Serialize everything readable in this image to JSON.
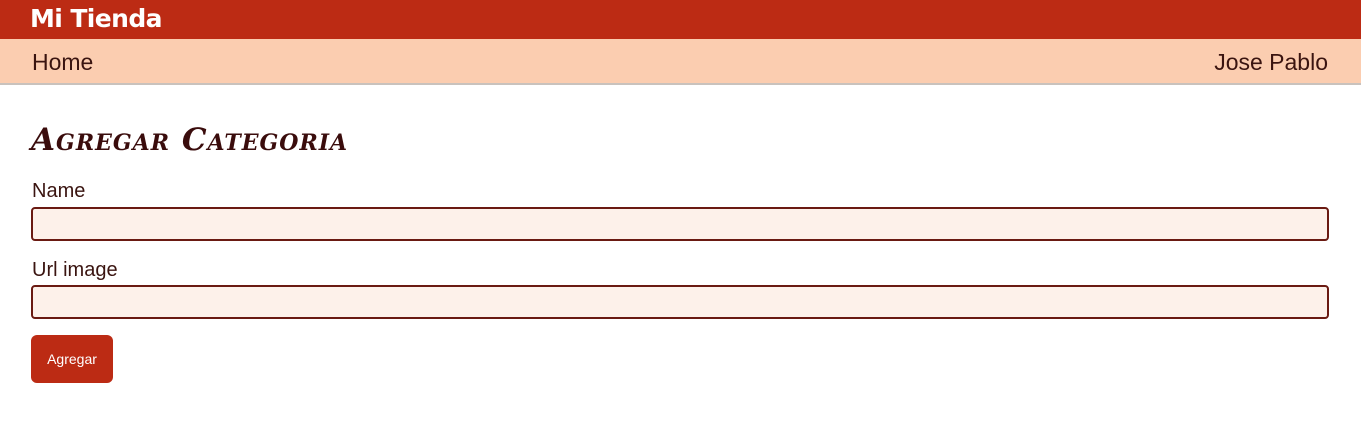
{
  "app": {
    "brand": "Mi Tienda"
  },
  "nav": {
    "home_label": "Home",
    "user_label": "Jose Pablo"
  },
  "form": {
    "title": "Agregar Categoria",
    "name_label": "Name",
    "name_value": "",
    "url_label": "Url image",
    "url_value": "",
    "submit_label": "Agregar"
  },
  "colors": {
    "brand_red": "#bc2b14",
    "nav_peach": "#fbcdb0",
    "input_bg": "#fdf1ea",
    "input_border": "#6a1a12",
    "text_dark": "#3a1410"
  }
}
